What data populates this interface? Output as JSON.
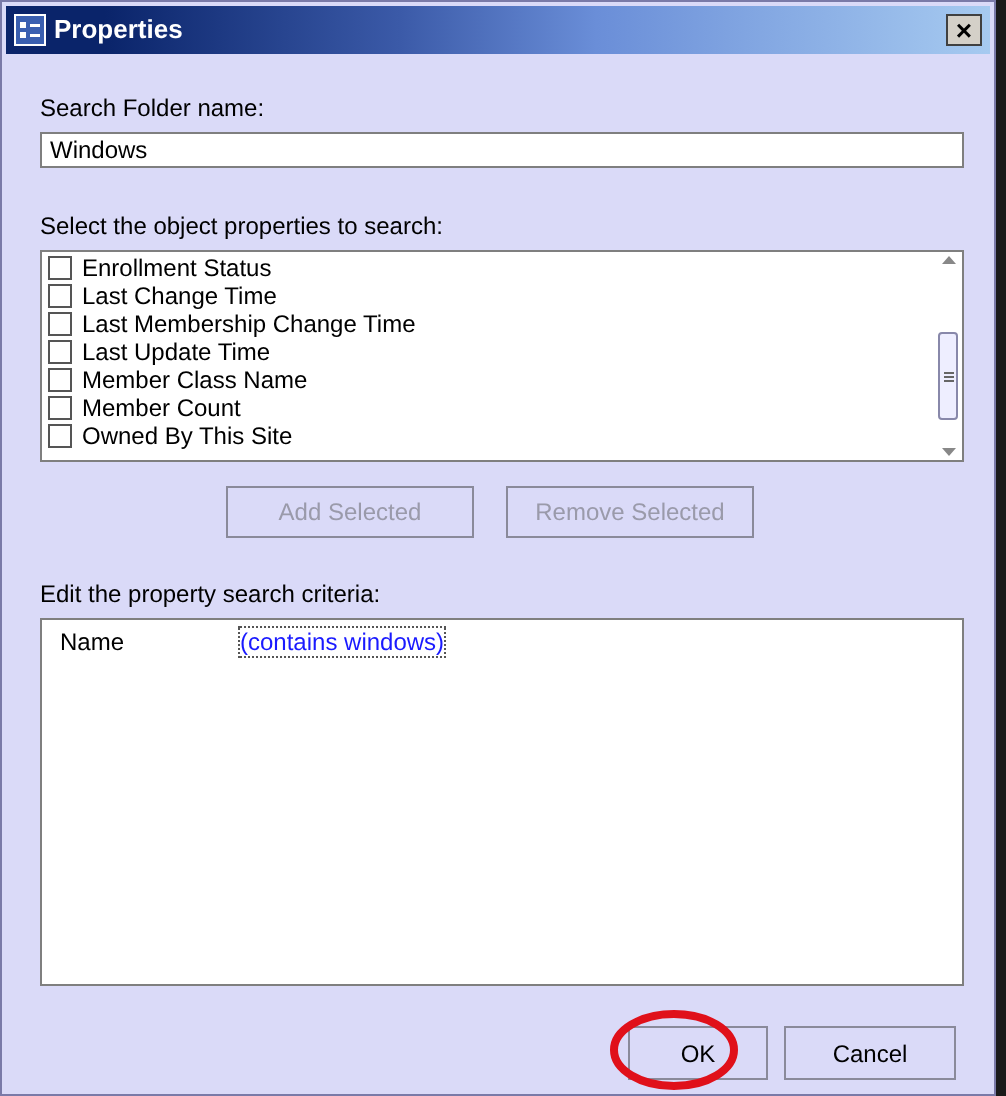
{
  "window": {
    "title": "Properties",
    "close": "×"
  },
  "folder_name": {
    "label": "Search Folder name:",
    "value": "Windows"
  },
  "properties": {
    "label": "Select the object properties to search:",
    "items": [
      {
        "label": "Enrollment Status",
        "checked": false
      },
      {
        "label": "Last Change Time",
        "checked": false
      },
      {
        "label": "Last Membership Change Time",
        "checked": false
      },
      {
        "label": "Last Update Time",
        "checked": false
      },
      {
        "label": "Member Class Name",
        "checked": false
      },
      {
        "label": "Member Count",
        "checked": false
      },
      {
        "label": "Owned By This Site",
        "checked": false
      }
    ]
  },
  "list_buttons": [
    {
      "label": "Add Selected",
      "disabled": true
    },
    {
      "label": "Remove Selected",
      "disabled": true
    }
  ],
  "criteria": {
    "label": "Edit the property search criteria:",
    "rows": [
      {
        "name": "Name",
        "value": "(contains windows)"
      }
    ]
  },
  "buttons": [
    {
      "label": "OK",
      "highlighted": true
    },
    {
      "label": "Cancel",
      "highlighted": false
    }
  ]
}
